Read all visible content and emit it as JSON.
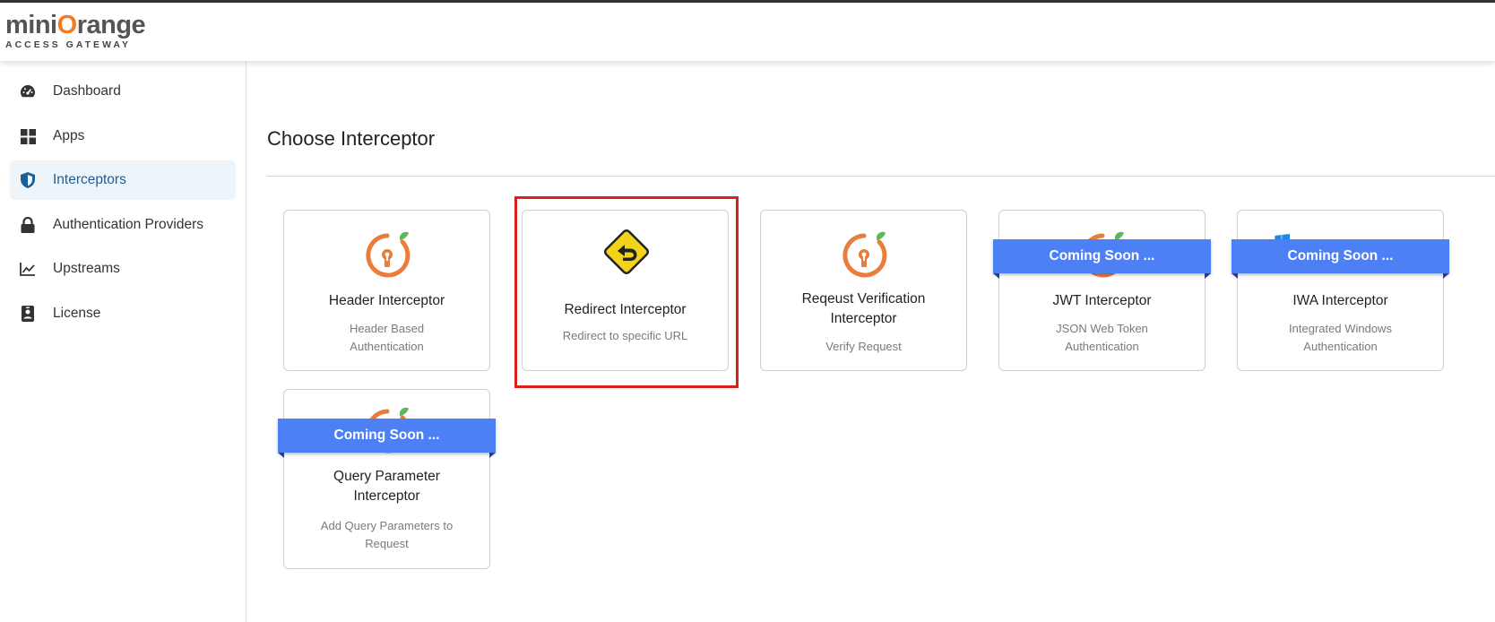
{
  "brand": {
    "logo_main": "miniOrange",
    "logo_sub": "ACCESS GATEWAY"
  },
  "sidebar": {
    "items": [
      {
        "label": "Dashboard",
        "icon": "dashboard-icon"
      },
      {
        "label": "Apps",
        "icon": "grid-icon"
      },
      {
        "label": "Interceptors",
        "icon": "shield-icon",
        "active": true
      },
      {
        "label": "Authentication Providers",
        "icon": "lock-icon"
      },
      {
        "label": "Upstreams",
        "icon": "chart-icon"
      },
      {
        "label": "License",
        "icon": "badge-icon"
      }
    ]
  },
  "main": {
    "title": "Choose Interceptor",
    "cards": [
      {
        "title": "Header Interceptor",
        "desc": "Header Based Authentication",
        "icon": "miniorange-icon"
      },
      {
        "title": "Redirect Interceptor",
        "desc": "Redirect to specific URL",
        "icon": "redirect-sign-icon",
        "highlighted": true
      },
      {
        "title": "Reqeust Verification Interceptor",
        "desc": "Verify Request",
        "icon": "miniorange-icon"
      },
      {
        "title": "JWT Interceptor",
        "desc": "JSON Web Token Authentication",
        "icon": "miniorange-icon",
        "badge": "Coming Soon ..."
      },
      {
        "title": "IWA Interceptor",
        "desc": "Integrated Windows Authentication",
        "icon": "windows-icon",
        "badge": "Coming Soon ..."
      },
      {
        "title": "Query Parameter Interceptor",
        "desc": "Add Query Parameters to Request",
        "icon": "miniorange-icon",
        "badge": "Coming Soon ..."
      }
    ]
  },
  "colors": {
    "accent": "#4d7ff5",
    "highlight": "#d9221c",
    "active_nav": "#1f5e95",
    "brand_orange": "#f47b20"
  }
}
